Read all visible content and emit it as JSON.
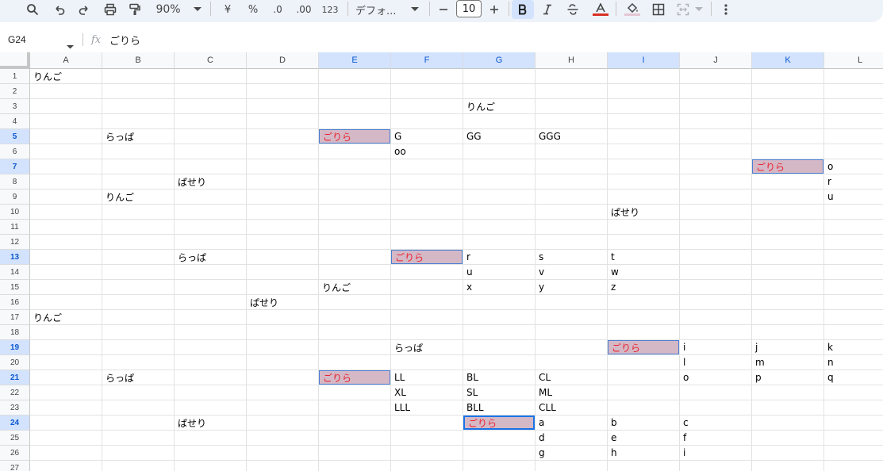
{
  "toolbar": {
    "zoom": "90%",
    "currency": "¥",
    "percent": "%",
    "decimal_decrease": ".0",
    "decimal_increase": ".00",
    "number_format": "123",
    "font_name": "デフォ...",
    "font_size": "10",
    "icons": [
      "search-icon",
      "undo-icon",
      "redo-icon",
      "print-icon",
      "paint-format-icon",
      "zoom-caret-icon",
      "font-caret-icon",
      "minus-icon",
      "plus-icon",
      "bold-icon",
      "italic-icon",
      "strikethrough-icon",
      "text-color-icon",
      "fill-color-icon",
      "borders-icon",
      "merge-icon",
      "more-vert-icon"
    ],
    "text_color": "#d93025",
    "fill_color": "#e6c6d4"
  },
  "formula_bar": {
    "name_box": "G24",
    "fx": "fx",
    "value": "ごりら"
  },
  "columns": [
    "A",
    "B",
    "C",
    "D",
    "E",
    "F",
    "G",
    "H",
    "I",
    "J",
    "K",
    "L"
  ],
  "selected_columns": [
    "E",
    "F",
    "G",
    "I",
    "K"
  ],
  "rows": [
    "1",
    "2",
    "3",
    "4",
    "5",
    "6",
    "7",
    "8",
    "9",
    "10",
    "11",
    "12",
    "13",
    "14",
    "15",
    "16",
    "17",
    "18",
    "19",
    "20",
    "21",
    "22",
    "23",
    "24",
    "25",
    "26",
    "27"
  ],
  "selected_rows": [
    "5",
    "7",
    "13",
    "19",
    "21",
    "24"
  ],
  "highlight_color": "#d5b8c6",
  "highlight_text_color": "#e8232f",
  "cells": [
    {
      "ref": "A1",
      "v": "りんご"
    },
    {
      "ref": "G3",
      "v": "りんご"
    },
    {
      "ref": "B5",
      "v": "らっぱ"
    },
    {
      "ref": "E5",
      "v": "ごりら",
      "hl": true
    },
    {
      "ref": "F5",
      "v": "G"
    },
    {
      "ref": "G5",
      "v": "GG"
    },
    {
      "ref": "H5",
      "v": "GGG"
    },
    {
      "ref": "F6",
      "v": "oo"
    },
    {
      "ref": "K7",
      "v": "ごりら",
      "hl": true
    },
    {
      "ref": "L7",
      "v": "o"
    },
    {
      "ref": "C8",
      "v": "ぱせり"
    },
    {
      "ref": "L8",
      "v": "r"
    },
    {
      "ref": "B9",
      "v": "りんご"
    },
    {
      "ref": "L9",
      "v": "u"
    },
    {
      "ref": "I10",
      "v": "ぱせり"
    },
    {
      "ref": "C13",
      "v": "らっぱ"
    },
    {
      "ref": "F13",
      "v": "ごりら",
      "hl": true
    },
    {
      "ref": "G13",
      "v": "r"
    },
    {
      "ref": "H13",
      "v": "s"
    },
    {
      "ref": "I13",
      "v": "t"
    },
    {
      "ref": "G14",
      "v": "u"
    },
    {
      "ref": "H14",
      "v": "v"
    },
    {
      "ref": "I14",
      "v": "w"
    },
    {
      "ref": "E15",
      "v": "りんご"
    },
    {
      "ref": "G15",
      "v": "x"
    },
    {
      "ref": "H15",
      "v": "y"
    },
    {
      "ref": "I15",
      "v": "z"
    },
    {
      "ref": "D16",
      "v": "ぱせり"
    },
    {
      "ref": "A17",
      "v": "りんご"
    },
    {
      "ref": "F19",
      "v": "らっぱ"
    },
    {
      "ref": "I19",
      "v": "ごりら",
      "hl": true
    },
    {
      "ref": "J19",
      "v": "i"
    },
    {
      "ref": "K19",
      "v": "j"
    },
    {
      "ref": "L19",
      "v": "k"
    },
    {
      "ref": "J20",
      "v": "l"
    },
    {
      "ref": "K20",
      "v": "m"
    },
    {
      "ref": "L20",
      "v": "n"
    },
    {
      "ref": "B21",
      "v": "らっぱ"
    },
    {
      "ref": "E21",
      "v": "ごりら",
      "hl": true
    },
    {
      "ref": "F21",
      "v": "LL"
    },
    {
      "ref": "G21",
      "v": "BL"
    },
    {
      "ref": "H21",
      "v": "CL"
    },
    {
      "ref": "J21",
      "v": "o"
    },
    {
      "ref": "K21",
      "v": "p"
    },
    {
      "ref": "L21",
      "v": "q"
    },
    {
      "ref": "F22",
      "v": "XL"
    },
    {
      "ref": "G22",
      "v": "SL"
    },
    {
      "ref": "H22",
      "v": "ML"
    },
    {
      "ref": "F23",
      "v": "LLL"
    },
    {
      "ref": "G23",
      "v": "BLL"
    },
    {
      "ref": "H23",
      "v": "CLL"
    },
    {
      "ref": "C24",
      "v": "ぱせり"
    },
    {
      "ref": "G24",
      "v": "ごりら",
      "hl": true,
      "active": true
    },
    {
      "ref": "H24",
      "v": "a"
    },
    {
      "ref": "I24",
      "v": "b"
    },
    {
      "ref": "J24",
      "v": "c"
    },
    {
      "ref": "H25",
      "v": "d"
    },
    {
      "ref": "I25",
      "v": "e"
    },
    {
      "ref": "J25",
      "v": "f"
    },
    {
      "ref": "H26",
      "v": "g"
    },
    {
      "ref": "I26",
      "v": "h"
    },
    {
      "ref": "J26",
      "v": "i"
    }
  ]
}
